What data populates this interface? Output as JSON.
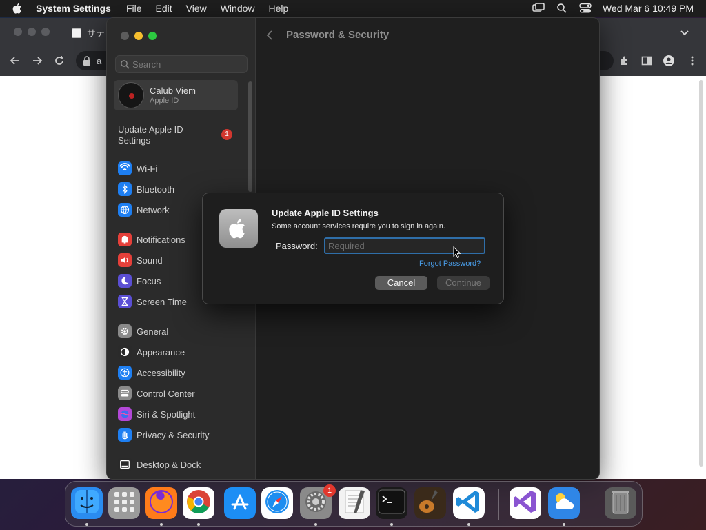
{
  "menubar": {
    "app_name": "System Settings",
    "menus": [
      "File",
      "Edit",
      "View",
      "Window",
      "Help"
    ],
    "clock": "Wed Mar 6  10:49 PM"
  },
  "browser": {
    "tab_title": "サテ",
    "address": "a"
  },
  "settings": {
    "search_placeholder": "Search",
    "account": {
      "name": "Calub Viem",
      "subtitle": "Apple ID"
    },
    "update_item": {
      "label": "Update Apple ID Settings",
      "badge": "1"
    },
    "sidebar_groups": [
      [
        {
          "id": "wifi",
          "label": "Wi-Fi",
          "icon": "wifi-icon",
          "color": "#1e7ff2"
        },
        {
          "id": "bluetooth",
          "label": "Bluetooth",
          "icon": "bluetooth-icon",
          "color": "#1e7ff2"
        },
        {
          "id": "network",
          "label": "Network",
          "icon": "globe-icon",
          "color": "#1e7ff2"
        }
      ],
      [
        {
          "id": "notifications",
          "label": "Notifications",
          "icon": "bell-icon",
          "color": "#e5403a"
        },
        {
          "id": "sound",
          "label": "Sound",
          "icon": "speaker-icon",
          "color": "#e5403a"
        },
        {
          "id": "focus",
          "label": "Focus",
          "icon": "moon-icon",
          "color": "#5b4fd4"
        },
        {
          "id": "screen-time",
          "label": "Screen Time",
          "icon": "hourglass-icon",
          "color": "#5b4fd4"
        }
      ],
      [
        {
          "id": "general",
          "label": "General",
          "icon": "gear-icon",
          "color": "#8a8a8a"
        },
        {
          "id": "appearance",
          "label": "Appearance",
          "icon": "appearance-icon",
          "color": "#2a2a2a"
        },
        {
          "id": "accessibility",
          "label": "Accessibility",
          "icon": "accessibility-icon",
          "color": "#1e7ff2"
        },
        {
          "id": "control-center",
          "label": "Control Center",
          "icon": "control-center-icon",
          "color": "#8a8a8a"
        },
        {
          "id": "siri-spotlight",
          "label": "Siri & Spotlight",
          "icon": "siri-icon",
          "color": "#b348d8"
        },
        {
          "id": "privacy-security",
          "label": "Privacy & Security",
          "icon": "hand-icon",
          "color": "#1e7ff2"
        }
      ],
      [
        {
          "id": "desktop-dock",
          "label": "Desktop & Dock",
          "icon": "dock-icon",
          "color": "#2a2a2a"
        }
      ]
    ],
    "page_title": "Password & Security"
  },
  "dialog": {
    "title": "Update Apple ID Settings",
    "message": "Some account services require you to sign in again.",
    "password_label": "Password:",
    "password_placeholder": "Required",
    "forgot_link": "Forgot Password?",
    "cancel_label": "Cancel",
    "continue_label": "Continue"
  },
  "dock": {
    "apps": [
      {
        "id": "finder",
        "icon": "finder-icon",
        "color": "#2a8cf0"
      },
      {
        "id": "launchpad",
        "icon": "launchpad-icon",
        "color": "#9b9b9b"
      },
      {
        "id": "firefox",
        "icon": "firefox-icon",
        "color": "#ff7b1a"
      },
      {
        "id": "chrome",
        "icon": "chrome-icon",
        "color": "#ffffff"
      },
      {
        "id": "app-store",
        "icon": "app-store-icon",
        "color": "#1c8ef5"
      },
      {
        "id": "safari",
        "icon": "safari-icon",
        "color": "#ffffff"
      },
      {
        "id": "system-settings",
        "icon": "settings-gear-icon",
        "color": "#8a8a8a",
        "badge": "1"
      },
      {
        "id": "textedit",
        "icon": "textedit-icon",
        "color": "#f2f2f2"
      },
      {
        "id": "terminal",
        "icon": "terminal-icon",
        "color": "#1a1a1a"
      },
      {
        "id": "garageband",
        "icon": "guitar-icon",
        "color": "#3a2a1a"
      },
      {
        "id": "vscode",
        "icon": "vscode-icon",
        "color": "#ffffff"
      },
      {
        "id": "visual-studio",
        "icon": "visual-studio-icon",
        "color": "#ffffff"
      },
      {
        "id": "weather",
        "icon": "weather-icon",
        "color": "#2f86e6"
      },
      {
        "id": "trash",
        "icon": "trash-icon",
        "color": "#5a5a5a"
      }
    ]
  }
}
